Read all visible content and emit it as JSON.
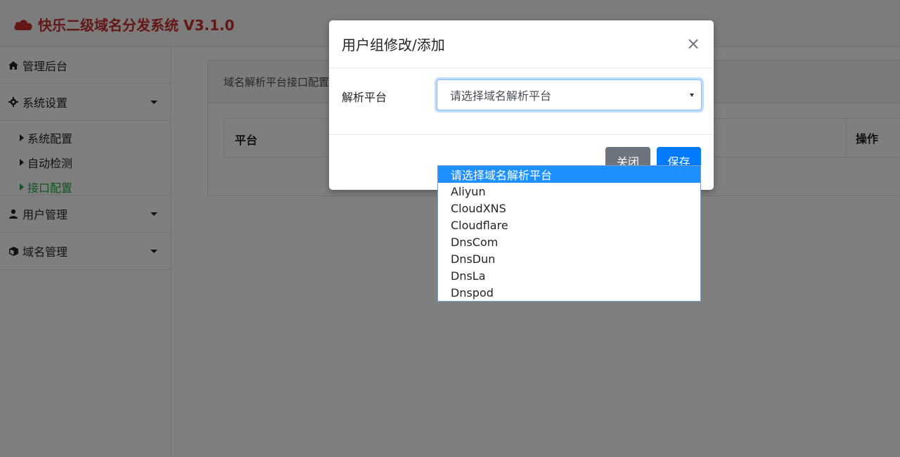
{
  "app": {
    "title": "快乐二级域名分发系统 V3.1.0"
  },
  "sidebar": {
    "items": [
      {
        "label": "管理后台",
        "icon": "home-icon"
      },
      {
        "label": "系统设置",
        "icon": "gear-icon"
      },
      {
        "label": "用户管理",
        "icon": "user-icon"
      },
      {
        "label": "域名管理",
        "icon": "cube-icon"
      }
    ],
    "sub_items": [
      {
        "label": "系统配置"
      },
      {
        "label": "自动检测"
      },
      {
        "label": "接口配置",
        "active": true
      }
    ]
  },
  "main": {
    "card_title": "域名解析平台接口配置",
    "table": {
      "columns": [
        "平台",
        "操作"
      ]
    }
  },
  "modal": {
    "title": "用户组修改/添加",
    "close_symbol": "×",
    "field_label": "解析平台",
    "select_value": "请选择域名解析平台",
    "buttons": {
      "close": "关闭",
      "save": "保存"
    }
  },
  "dropdown": {
    "options": [
      "请选择域名解析平台",
      "Aliyun",
      "CloudXNS",
      "Cloudflare",
      "DnsCom",
      "DnsDun",
      "DnsLa",
      "Dnspod"
    ],
    "highlighted_index": 0
  },
  "colors": {
    "brand": "#c9302c",
    "active_link": "#28a745",
    "primary": "#007bff",
    "secondary": "#6c757d",
    "dropdown_highlight": "#1e90ff"
  }
}
